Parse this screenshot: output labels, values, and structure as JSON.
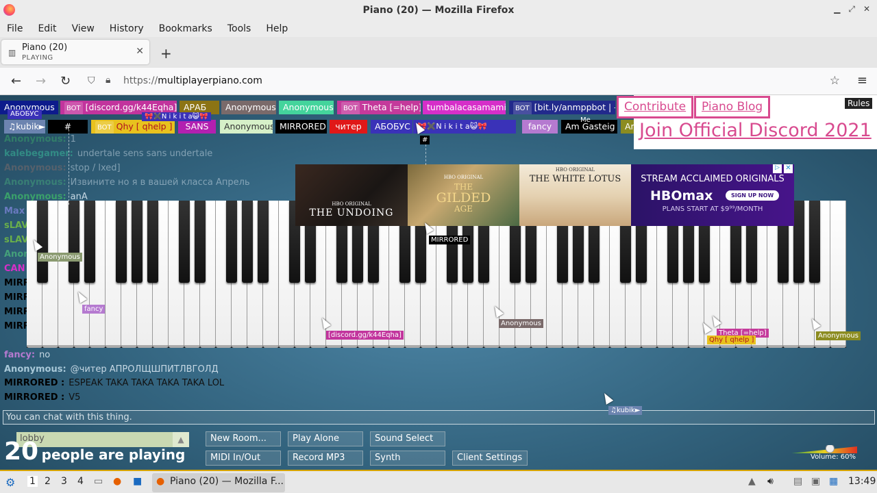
{
  "window": {
    "title": "Piano (20) — Mozilla Firefox"
  },
  "menu": [
    "File",
    "Edit",
    "View",
    "History",
    "Bookmarks",
    "Tools",
    "Help"
  ],
  "tab": {
    "title": "Piano (20)",
    "subtitle": "PLAYING"
  },
  "url": {
    "scheme": "https://",
    "host": "multiplayerpiano.com"
  },
  "users_row1": [
    {
      "name": "Anonymous",
      "color": "#0d1b8c",
      "bot": false
    },
    {
      "name": "[discord.gg/k44Eqha]",
      "color": "#c2349d",
      "bot": true
    },
    {
      "name": "АРАБ",
      "color": "#8c7414",
      "bot": false
    },
    {
      "name": "Anonymous",
      "color": "#7a6a6a",
      "bot": false
    },
    {
      "name": "Anonymous",
      "color": "#44d49c",
      "bot": false
    },
    {
      "name": "Theta [=help]",
      "color": "#c43a9b",
      "bot": true
    },
    {
      "name": "tumbalacasamami",
      "color": "#d62fc9",
      "bot": false
    },
    {
      "name": "[bit.ly/anmppbot | -h]",
      "color": "#222a8c",
      "bot": true
    }
  ],
  "users_row2": [
    {
      "name": "♫kubik►",
      "color": "#6c84b0"
    },
    {
      "name": "#",
      "color": "#000000"
    },
    {
      "name": "Qhy [ qhelp ]",
      "color": "#e8c21e",
      "bot": true
    },
    {
      "name": "SANS",
      "color": "#b320b0"
    },
    {
      "name": "Anonymous",
      "color": "#d6f0c8"
    },
    {
      "name": "MIRRORED",
      "color": "#000000"
    },
    {
      "name": "читер",
      "color": "#e01818"
    },
    {
      "name": "АБОБУС",
      "color": "#3a32b8"
    },
    {
      "name": "fancy",
      "color": "#b57ad0"
    },
    {
      "name": "Am Gasteig",
      "color": "#000000"
    },
    {
      "name": "An",
      "color": "#8c8c20"
    }
  ],
  "nikita_label": "🎀✖️N i k i t a😺🎀",
  "abobus_small": "АБОБУС",
  "me_label": "Me",
  "links": {
    "contribute": "Contribute",
    "blog": "Piano Blog",
    "discord": "Join Official Discord 2021",
    "rules": "Rules"
  },
  "chat": [
    {
      "name": "Anonymous:",
      "text": "1",
      "color": "#3aa06a"
    },
    {
      "name": "kalebegamer:",
      "text": "undertale sens sans undertale",
      "color": "#3ab89a"
    },
    {
      "name": "Anonymous:",
      "text": "stop / lxed]",
      "color": "#7a6a6a"
    },
    {
      "name": "Anonymous:",
      "text": "Извините но я в вашей класса Апрель",
      "color": "#44a07a"
    },
    {
      "name": "Anonymous:",
      "text": "anA",
      "color": "#3aa06a"
    },
    {
      "name": "Max",
      "text": "",
      "color": "#6a7ac0"
    },
    {
      "name": "sLAV",
      "text": "",
      "color": "#6ab04a"
    },
    {
      "name": "sLAV",
      "text": "",
      "color": "#6ab04a"
    },
    {
      "name": "Anon",
      "text": "",
      "color": "#44a07a"
    },
    {
      "name": "CAN",
      "text": "",
      "color": "#d62fc9"
    },
    {
      "name": "MIRR",
      "text": "",
      "color": "#000000"
    },
    {
      "name": "MIRR",
      "text": "",
      "color": "#000000"
    },
    {
      "name": "MIRR",
      "text": "",
      "color": "#000000"
    },
    {
      "name": "MIRR",
      "text": "",
      "color": "#000000"
    },
    {
      "name": "fancy:",
      "text": "no",
      "color": "#b57ad0"
    },
    {
      "name": "Anonymous:",
      "text": "@читер АПРОЛЩШПИТЛВГОЛД",
      "color": "#a8c8d8"
    },
    {
      "name": "MIRRORED :",
      "text": "ESPEAK TAKA TAKA TAKA TAKA LOL",
      "color": "#000000"
    },
    {
      "name": "MIRRORED :",
      "text": "V5",
      "color": "#000000"
    }
  ],
  "cursor_tags": [
    {
      "name": "Anonymous",
      "color": "#8a9a70"
    },
    {
      "name": "fancy",
      "color": "#b57ad0"
    },
    {
      "name": "[discord.gg/k44Eqha]",
      "color": "#c2349d"
    },
    {
      "name": "MIRRORED",
      "color": "#000000"
    },
    {
      "name": "Anonymous",
      "color": "#7a6a6a"
    },
    {
      "name": "Theta [=help]",
      "color": "#c43a9b"
    },
    {
      "name": "Qhy [ qhelp ]",
      "color": "#e8c21e"
    },
    {
      "name": "Anonymous",
      "color": "#8c8c20"
    },
    {
      "name": "♫kubik►",
      "color": "#6c84b0"
    },
    {
      "name": "#",
      "color": "#000000"
    }
  ],
  "ad": {
    "hbo": "HBO ORIGINAL",
    "p1": "THE UNDOING",
    "p2a": "THE",
    "p2b": "GILDED",
    "p2c": "AGE",
    "p3": "THE WHITE LOTUS",
    "p4a": "STREAM ACCLAIMED ORIGINALS",
    "p4b": "HBOmax",
    "p4c": "SIGN UP NOW",
    "p4d": "PLANS START AT $9⁹⁹/MONTH"
  },
  "chat_placeholder": "You can chat with this thing.",
  "controls": {
    "lobby": "lobby",
    "count": "20",
    "count_text": "people are playing",
    "buttons": [
      "New Room...",
      "Play Alone",
      "Sound Select",
      "MIDI In/Out",
      "Record MP3",
      "Synth",
      "Client Settings"
    ],
    "volume": "Volume: 60%",
    "volume_level": 0.6
  },
  "taskbar": {
    "workspaces": [
      "1",
      "2",
      "3",
      "4"
    ],
    "task": "Piano (20) — Mozilla F...",
    "clock": "13:49"
  }
}
